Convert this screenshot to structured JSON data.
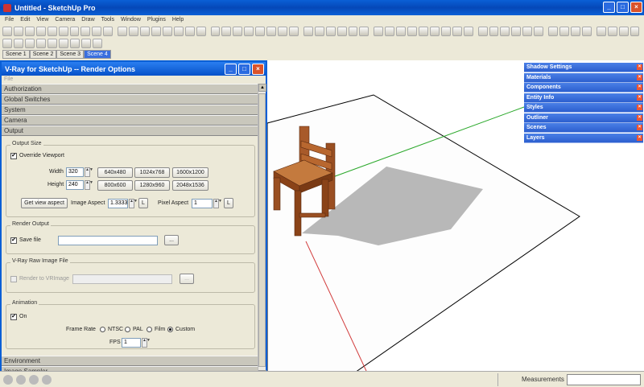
{
  "app": {
    "title": "Untitled - SketchUp Pro"
  },
  "menu": [
    "File",
    "Edit",
    "View",
    "Camera",
    "Draw",
    "Tools",
    "Window",
    "Plugins",
    "Help"
  ],
  "scenes": [
    {
      "label": "Scene 1",
      "active": false
    },
    {
      "label": "Scene 2",
      "active": false
    },
    {
      "label": "Scene 3",
      "active": false
    },
    {
      "label": "Scene 4",
      "active": true
    }
  ],
  "vray": {
    "title": "V-Ray for SketchUp -- Render Options",
    "file_menu": "File",
    "top_rollouts": [
      "Authorization",
      "Global Switches",
      "System",
      "Camera",
      "Output"
    ],
    "bottom_rollouts": [
      "Environment",
      "Image Sampler"
    ],
    "output_size": {
      "title": "Output Size",
      "override_label": "Override Viewport",
      "override_checked": "✔",
      "width_label": "Width",
      "width_value": "320",
      "height_label": "Height",
      "height_value": "240",
      "presets": [
        "640x480",
        "1024x768",
        "1600x1200",
        "800x600",
        "1280x960",
        "2048x1536"
      ],
      "get_view_aspect": "Get view aspect",
      "image_aspect_label": "Image Aspect",
      "image_aspect_value": "1.3333",
      "pixel_aspect_label": "Pixel Aspect",
      "pixel_aspect_value": "1",
      "lock_label": "L"
    },
    "render_output": {
      "title": "Render Output",
      "save_file_label": "Save file",
      "save_file_checked": "✔",
      "path_value": "",
      "browse_label": "..."
    },
    "raw_image": {
      "title": "V-Ray Raw Image File",
      "render_to_label": "Render to VRImage",
      "path_value": "",
      "browse_label": "..."
    },
    "animation": {
      "title": "Animation",
      "on_label": "On",
      "on_checked": "✔",
      "frame_rate_label": "Frame Rate",
      "frame_rates": [
        "NTSC",
        "PAL",
        "Film",
        "Custom"
      ],
      "selected_frame_rate": "Custom",
      "fps_label": "FPS",
      "fps_value": "1"
    }
  },
  "trays": [
    "Shadow Settings",
    "Materials",
    "Components",
    "Entity Info",
    "Styles",
    "Outliner",
    "Scenes",
    "Layers"
  ],
  "status": {
    "measurements_label": "Measurements",
    "measurements_value": ""
  },
  "colors": {
    "titlebar": "#0a5fd6",
    "tray": "#3a6ede",
    "axis_green": "#2aa82a",
    "axis_red": "#d23c3c",
    "chair_wood": "#a85a2a"
  }
}
